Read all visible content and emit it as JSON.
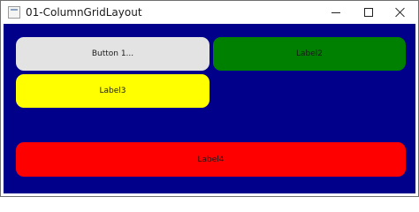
{
  "window": {
    "title": "01-ColumnGridLayout",
    "icon": "app-window-icon",
    "controls": {
      "minimize_icon": "minimize-icon",
      "maximize_icon": "maximize-icon",
      "close_icon": "close-icon"
    }
  },
  "content": {
    "background_color": "#00008b",
    "button1": {
      "label": "Button 1...",
      "color": "#e3e3e3"
    },
    "label2": {
      "text": "Label2",
      "color": "#008000"
    },
    "label3": {
      "text": "Label3",
      "color": "#ffff00"
    },
    "label4": {
      "text": "Label4",
      "color": "#ff0000"
    }
  }
}
